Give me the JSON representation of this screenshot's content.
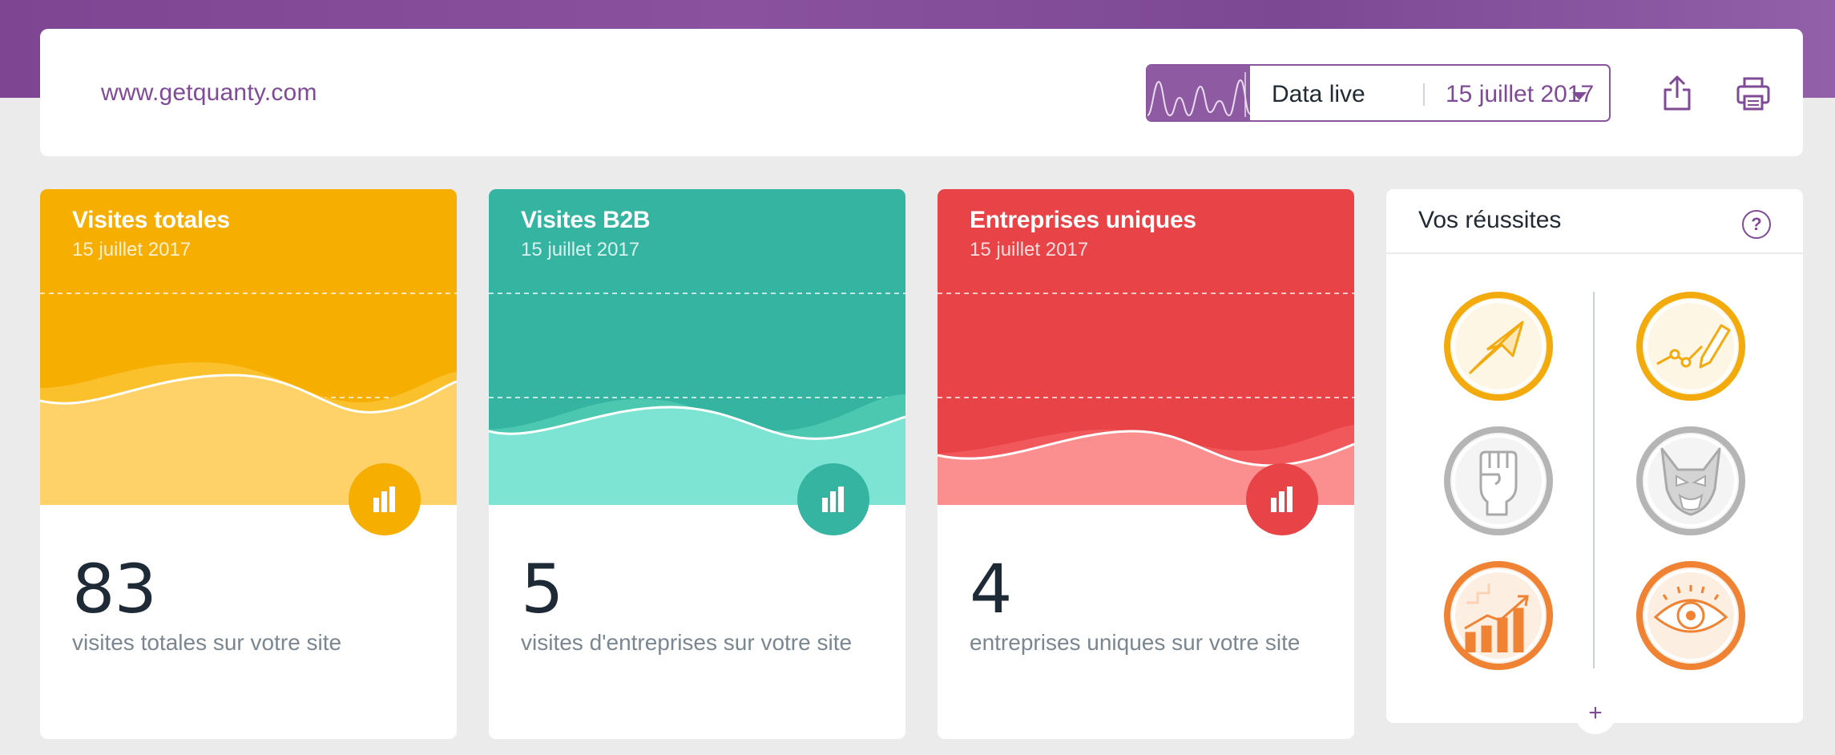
{
  "header": {
    "site_url": "www.getquanty.com",
    "live_label": "Data live",
    "selected_date": "15 juillet 2017",
    "share_icon": "share-icon",
    "print_icon": "print-icon"
  },
  "cards": [
    {
      "title": "Visites totales",
      "date": "15 juillet 2017",
      "value": "83",
      "description": "visites totales sur votre site",
      "accent": "#f6ae00",
      "wave_back": "#fbc12d",
      "wave_front": "#fed268"
    },
    {
      "title": "Visites B2B",
      "date": "15 juillet 2017",
      "value": "5",
      "description": "visites d'entreprises sur votre site",
      "accent": "#35b4a1",
      "wave_back": "#4cc8b0",
      "wave_front": "#7de3d3"
    },
    {
      "title": "Entreprises uniques",
      "date": "15 juillet 2017",
      "value": "4",
      "description": "entreprises uniques sur votre site",
      "accent": "#e84447",
      "wave_back": "#f0585b",
      "wave_front": "#fb8e8e"
    }
  ],
  "success": {
    "title": "Vos réussites",
    "help_label": "?",
    "more_label": "+",
    "badges": [
      {
        "icon": "paper-plane-badge-icon",
        "status": "earned",
        "color": "#f2aa0c"
      },
      {
        "icon": "pencil-chart-badge-icon",
        "status": "earned",
        "color": "#f2aa0c"
      },
      {
        "icon": "fist-badge-icon",
        "status": "locked",
        "color": "#b5b5b5"
      },
      {
        "icon": "wolverine-badge-icon",
        "status": "locked",
        "color": "#b5b5b5"
      },
      {
        "icon": "growth-chart-badge-icon",
        "status": "earned",
        "color": "#ef8233"
      },
      {
        "icon": "eye-badge-icon",
        "status": "earned",
        "color": "#ef8233"
      }
    ]
  }
}
